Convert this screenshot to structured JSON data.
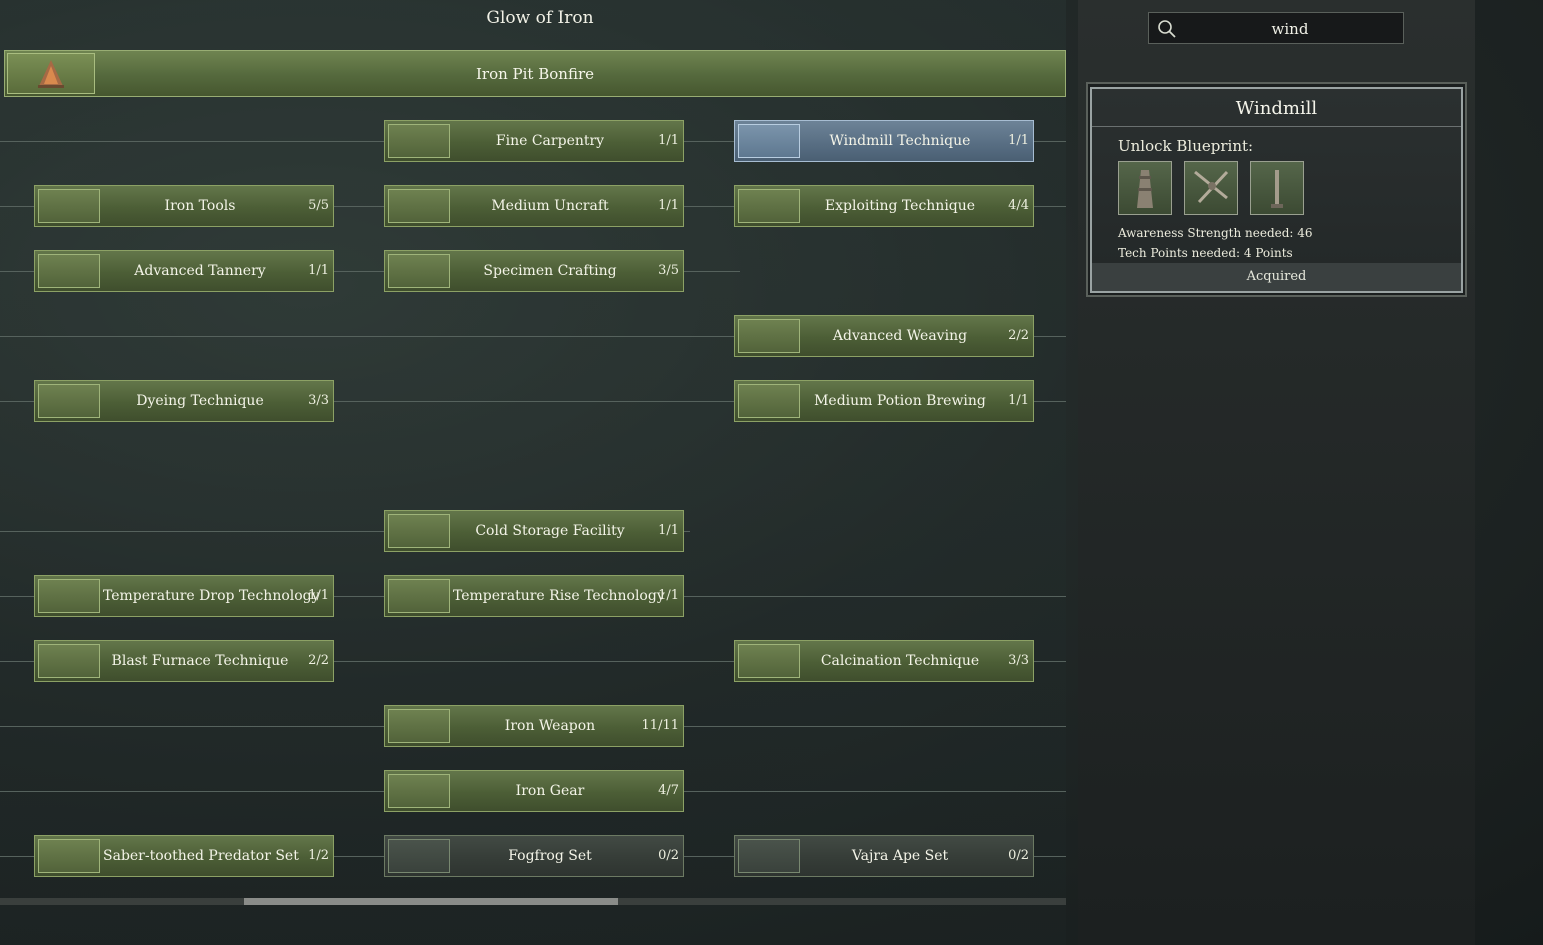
{
  "tree": {
    "title": "Glow of Iron",
    "root": {
      "label": "Iron Pit Bonfire",
      "icon": "bonfire-icon"
    },
    "nodes": [
      {
        "label": "Fine Carpentry",
        "count": "1/1",
        "icon": "workbench-icon",
        "state": "unlocked"
      },
      {
        "label": "Windmill Technique",
        "count": "1/1",
        "icon": "windmill-icon",
        "state": "selected"
      },
      {
        "label": "Iron Tools",
        "count": "5/5",
        "icon": "axe-icon",
        "state": "unlocked"
      },
      {
        "label": "Medium Uncraft",
        "count": "1/1",
        "icon": "uncraft-bench-icon",
        "state": "unlocked"
      },
      {
        "label": "Exploiting Technique",
        "count": "4/4",
        "icon": "mining-rig-icon",
        "state": "unlocked"
      },
      {
        "label": "Advanced Tannery",
        "count": "1/1",
        "icon": "tannery-icon",
        "state": "unlocked"
      },
      {
        "label": "Specimen Crafting",
        "count": "3/5",
        "icon": "specimen-icon",
        "state": "unlocked"
      },
      {
        "label": "Advanced Weaving",
        "count": "2/2",
        "icon": "loom-icon",
        "state": "unlocked"
      },
      {
        "label": "Dyeing Technique",
        "count": "3/3",
        "icon": "dye-vat-icon",
        "state": "unlocked"
      },
      {
        "label": "Medium Potion Brewing",
        "count": "1/1",
        "icon": "brewing-table-icon",
        "state": "unlocked"
      },
      {
        "label": "Cold Storage Facility",
        "count": "1/1",
        "icon": "fridge-icon",
        "state": "unlocked"
      },
      {
        "label": "Temperature Drop Technology",
        "count": "1/1",
        "icon": "cooler-icon",
        "state": "unlocked"
      },
      {
        "label": "Temperature Rise Technology",
        "count": "1/1",
        "icon": "heater-icon",
        "state": "unlocked"
      },
      {
        "label": "Blast Furnace Technique",
        "count": "2/2",
        "icon": "furnace-icon",
        "state": "unlocked"
      },
      {
        "label": "Calcination Technique",
        "count": "3/3",
        "icon": "kiln-icon",
        "state": "unlocked"
      },
      {
        "label": "Iron Weapon",
        "count": "11/11",
        "icon": "spear-icon",
        "state": "unlocked"
      },
      {
        "label": "Iron Gear",
        "count": "4/7",
        "icon": "armor-icon",
        "state": "unlocked"
      },
      {
        "label": "Saber-toothed Predator Set",
        "count": "1/2",
        "icon": "fur-armor-icon",
        "state": "unlocked"
      },
      {
        "label": "Fogfrog Set",
        "count": "0/2",
        "icon": "red-armor-icon",
        "state": "locked"
      },
      {
        "label": "Vajra Ape Set",
        "count": "0/2",
        "icon": "ape-armor-icon",
        "state": "locked"
      }
    ]
  },
  "search": {
    "value": "wind",
    "icon": "search-icon"
  },
  "detail": {
    "title": "Windmill",
    "unlock_label": "Unlock Blueprint:",
    "blueprints": [
      {
        "icon": "windmill-tower-icon"
      },
      {
        "icon": "windmill-blades-icon"
      },
      {
        "icon": "pole-icon"
      }
    ],
    "awareness": "Awareness Strength needed: 46",
    "tech_points": "Tech Points needed: 4 Points",
    "status": "Acquired"
  },
  "colors": {
    "node_green": "#4c5e36",
    "node_selected": "#576d82",
    "node_locked": "#353c37",
    "border_green": "#8ca165"
  }
}
